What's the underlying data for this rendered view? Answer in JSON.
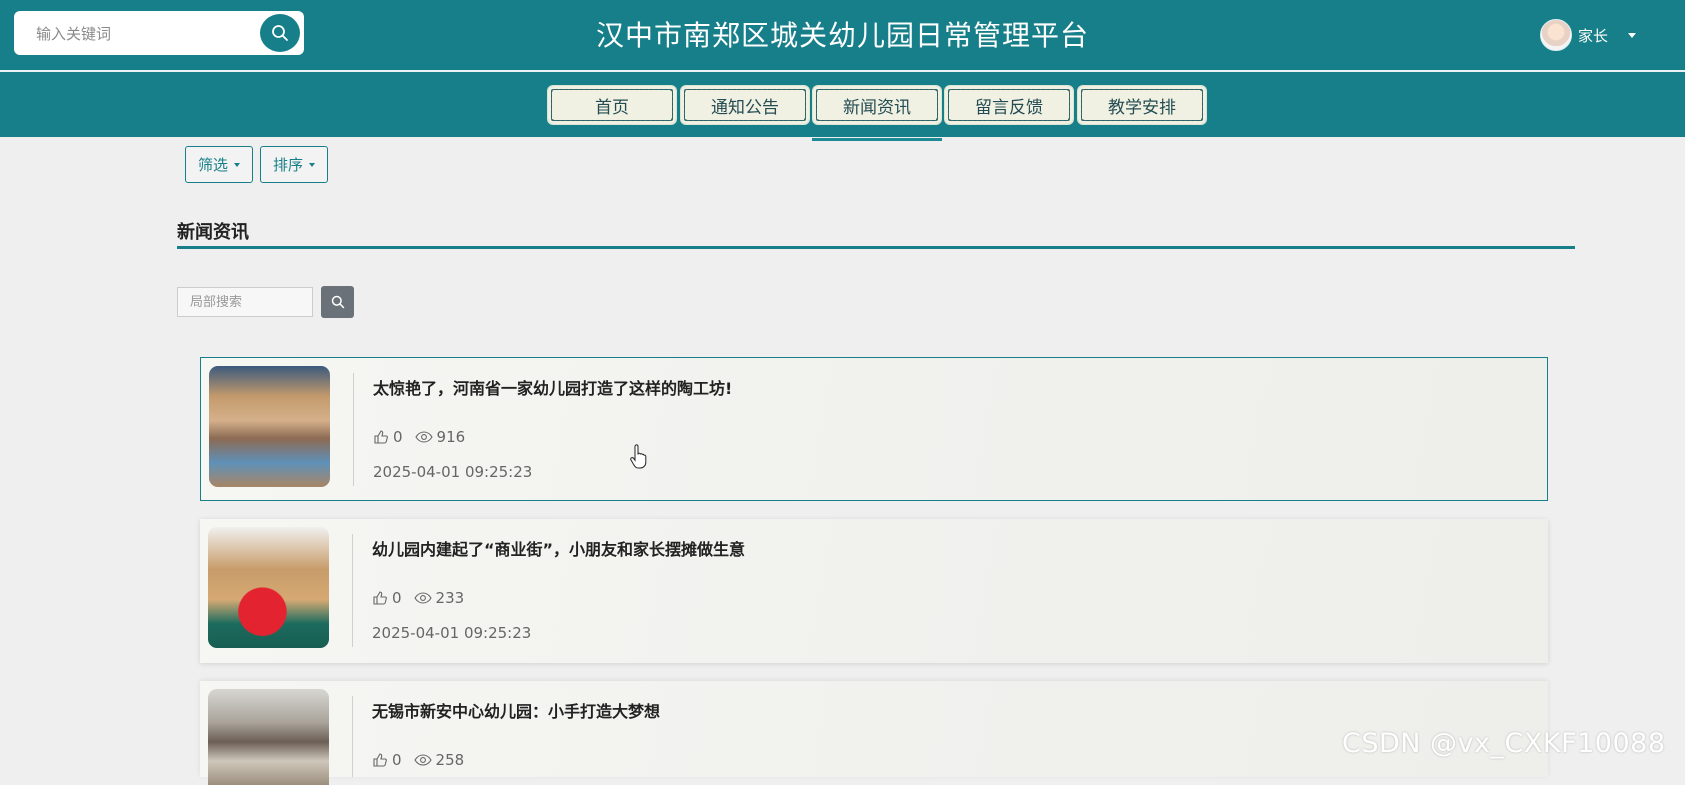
{
  "header": {
    "search_placeholder": "输入关键词",
    "site_title": "汉中市南郑区城关幼儿园日常管理平台",
    "user_name": "家长"
  },
  "nav": {
    "items": [
      {
        "label": "首页"
      },
      {
        "label": "通知公告"
      },
      {
        "label": "新闻资讯"
      },
      {
        "label": "留言反馈"
      },
      {
        "label": "教学安排"
      }
    ],
    "active": "新闻资讯"
  },
  "toolbar": {
    "filter_label": "筛选",
    "sort_label": "排序"
  },
  "section": {
    "title": "新闻资讯",
    "local_search_placeholder": "局部搜索"
  },
  "news": [
    {
      "title": "太惊艳了，河南省一家幼儿园打造了这样的陶工坊!",
      "likes": "0",
      "views": "916",
      "time": "2025-04-01 09:25:23"
    },
    {
      "title": "幼儿园内建起了“商业街”，小朋友和家长摆摊做生意",
      "likes": "0",
      "views": "233",
      "time": "2025-04-01 09:25:23"
    },
    {
      "title": "无锡市新安中心幼儿园：小手打造大梦想",
      "likes": "0",
      "views": "258",
      "time": ""
    }
  ],
  "colors": {
    "brand": "#177f89",
    "nav_button_bg": "#f0f0e3",
    "page_bg": "#efefef"
  },
  "watermark": "CSDN @vx_CXKF10088"
}
